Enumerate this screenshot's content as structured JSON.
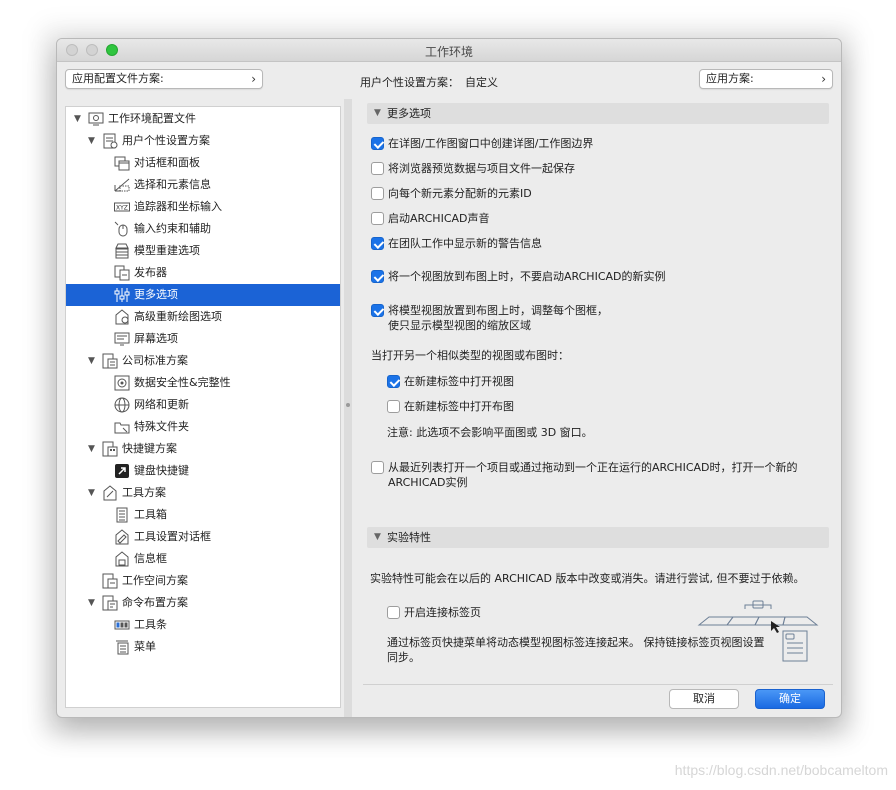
{
  "window": {
    "title": "工作环境"
  },
  "header": {
    "profile_combo": "应用配置文件方案:",
    "user_scheme_label": "用户个性设置方案：",
    "user_scheme_value": "自定义",
    "apply_combo": "应用方案:"
  },
  "tree": {
    "items": [
      {
        "label": "工作环境配置文件",
        "level": 0,
        "expanded": true,
        "icon": "workspace-profile-icon"
      },
      {
        "label": "用户个性设置方案",
        "level": 1,
        "expanded": true,
        "icon": "user-scheme-icon"
      },
      {
        "label": "对话框和面板",
        "level": 2,
        "icon": "dialog-panel-icon"
      },
      {
        "label": "选择和元素信息",
        "level": 2,
        "icon": "selection-info-icon"
      },
      {
        "label": "追踪器和坐标输入",
        "level": 2,
        "icon": "xyz-tracker-icon"
      },
      {
        "label": "输入约束和辅助",
        "level": 2,
        "icon": "mouse-constraint-icon"
      },
      {
        "label": "模型重建选项",
        "level": 2,
        "icon": "rebuild-model-icon"
      },
      {
        "label": "发布器",
        "level": 2,
        "icon": "publisher-icon"
      },
      {
        "label": "更多选项",
        "level": 2,
        "icon": "more-options-icon",
        "selected": true
      },
      {
        "label": "高级重新绘图选项",
        "level": 2,
        "icon": "redraw-options-icon"
      },
      {
        "label": "屏幕选项",
        "level": 2,
        "icon": "screen-options-icon"
      },
      {
        "label": "公司标准方案",
        "level": 1,
        "expanded": true,
        "icon": "company-standards-icon"
      },
      {
        "label": "数据安全性&完整性",
        "level": 2,
        "icon": "data-safety-icon"
      },
      {
        "label": "网络和更新",
        "level": 2,
        "icon": "network-globe-icon"
      },
      {
        "label": "特殊文件夹",
        "level": 2,
        "icon": "special-folder-icon"
      },
      {
        "label": "快捷键方案",
        "level": 1,
        "expanded": true,
        "icon": "shortcut-scheme-icon"
      },
      {
        "label": "键盘快捷键",
        "level": 2,
        "icon": "keyboard-shortcut-icon"
      },
      {
        "label": "工具方案",
        "level": 1,
        "expanded": true,
        "icon": "tool-scheme-icon"
      },
      {
        "label": "工具箱",
        "level": 2,
        "icon": "toolbox-icon"
      },
      {
        "label": "工具设置对话框",
        "level": 2,
        "icon": "tool-settings-icon"
      },
      {
        "label": "信息框",
        "level": 2,
        "icon": "info-box-icon"
      },
      {
        "label": "工作空间方案",
        "level": 1,
        "expanded": false,
        "icon": "work-space-icon"
      },
      {
        "label": "命令布置方案",
        "level": 1,
        "expanded": true,
        "icon": "command-layout-icon"
      },
      {
        "label": "工具条",
        "level": 2,
        "icon": "toolbar-icon"
      },
      {
        "label": "菜单",
        "level": 2,
        "icon": "menu-icon"
      }
    ]
  },
  "more_options": {
    "title": "更多选项",
    "options": [
      {
        "label": "在详图/工作图窗口中创建详图/工作图边界",
        "checked": true
      },
      {
        "label": "将浏览器预览数据与项目文件一起保存",
        "checked": false
      },
      {
        "label": "向每个新元素分配新的元素ID",
        "checked": false
      },
      {
        "label": "启动ARCHICAD声音",
        "checked": false
      },
      {
        "label": "在团队工作中显示新的警告信息",
        "checked": true
      },
      {
        "label": "将一个视图放到布图上时，不要启动ARCHICAD的新实例",
        "checked": true
      },
      {
        "label": "将模型视图放置到布图上时，调整每个图框，",
        "label2": "使只显示模型视图的缩放区域",
        "checked": true
      }
    ],
    "similar_label": "当打开另一个相似类型的视图或布图时：",
    "sub_options": [
      {
        "label": "在新建标签中打开视图",
        "checked": true
      },
      {
        "label": "在新建标签中打开布图",
        "checked": false
      }
    ],
    "note": "注意: 此选项不会影响平面图或 3D 窗口。",
    "recent_option": {
      "label": "从最近列表打开一个项目或通过拖动到一个正在运行的ARCHICAD时，打开一个新的",
      "label2": "ARCHICAD实例",
      "checked": false
    }
  },
  "experimental": {
    "title": "实验特性",
    "description": "实验特性可能会在以后的 ARCHICAD 版本中改变或消失。请进行尝试, 但不要过于依赖。",
    "option": {
      "label": "开启连接标签页",
      "checked": false
    },
    "option_desc": "通过标签页快捷菜单将动态模型视图标签连接起来。 保持链接标签页视图设置",
    "option_desc2": "同步。"
  },
  "buttons": {
    "cancel": "取消",
    "ok": "确定"
  },
  "watermark": "https://blog.csdn.net/bobcameltom"
}
